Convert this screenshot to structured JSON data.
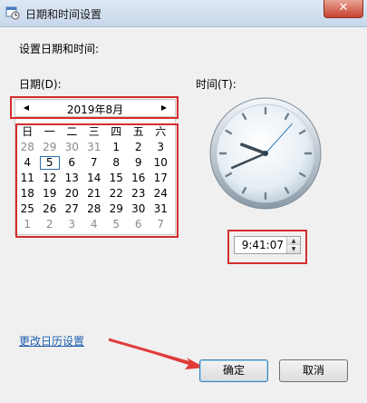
{
  "window": {
    "title": "日期和时间设置",
    "close_glyph": "✕"
  },
  "heading": "设置日期和时间:",
  "date_label": "日期(D):",
  "time_label": "时间(T):",
  "calendar": {
    "month_title": "2019年8月",
    "prev_glyph": "◀",
    "next_glyph": "▶",
    "weekdays": [
      "日",
      "一",
      "二",
      "三",
      "四",
      "五",
      "六"
    ],
    "weeks": [
      [
        "28",
        "29",
        "30",
        "31",
        "1",
        "2",
        "3"
      ],
      [
        "4",
        "5",
        "6",
        "7",
        "8",
        "9",
        "10"
      ],
      [
        "11",
        "12",
        "13",
        "14",
        "15",
        "16",
        "17"
      ],
      [
        "18",
        "19",
        "20",
        "21",
        "22",
        "23",
        "24"
      ],
      [
        "25",
        "26",
        "27",
        "28",
        "29",
        "30",
        "31"
      ],
      [
        "1",
        "2",
        "3",
        "4",
        "5",
        "6",
        "7"
      ]
    ],
    "selected_day": "5"
  },
  "clock": {
    "hour": 9,
    "minute": 41,
    "second": 7
  },
  "time": {
    "value": "9:41:07",
    "up_glyph": "▲",
    "down_glyph": "▼"
  },
  "link": "更改日历设置",
  "buttons": {
    "ok": "确定",
    "cancel": "取消"
  },
  "colors": {
    "annotation_red": "#d52d2d",
    "link_blue": "#1f5fae"
  }
}
